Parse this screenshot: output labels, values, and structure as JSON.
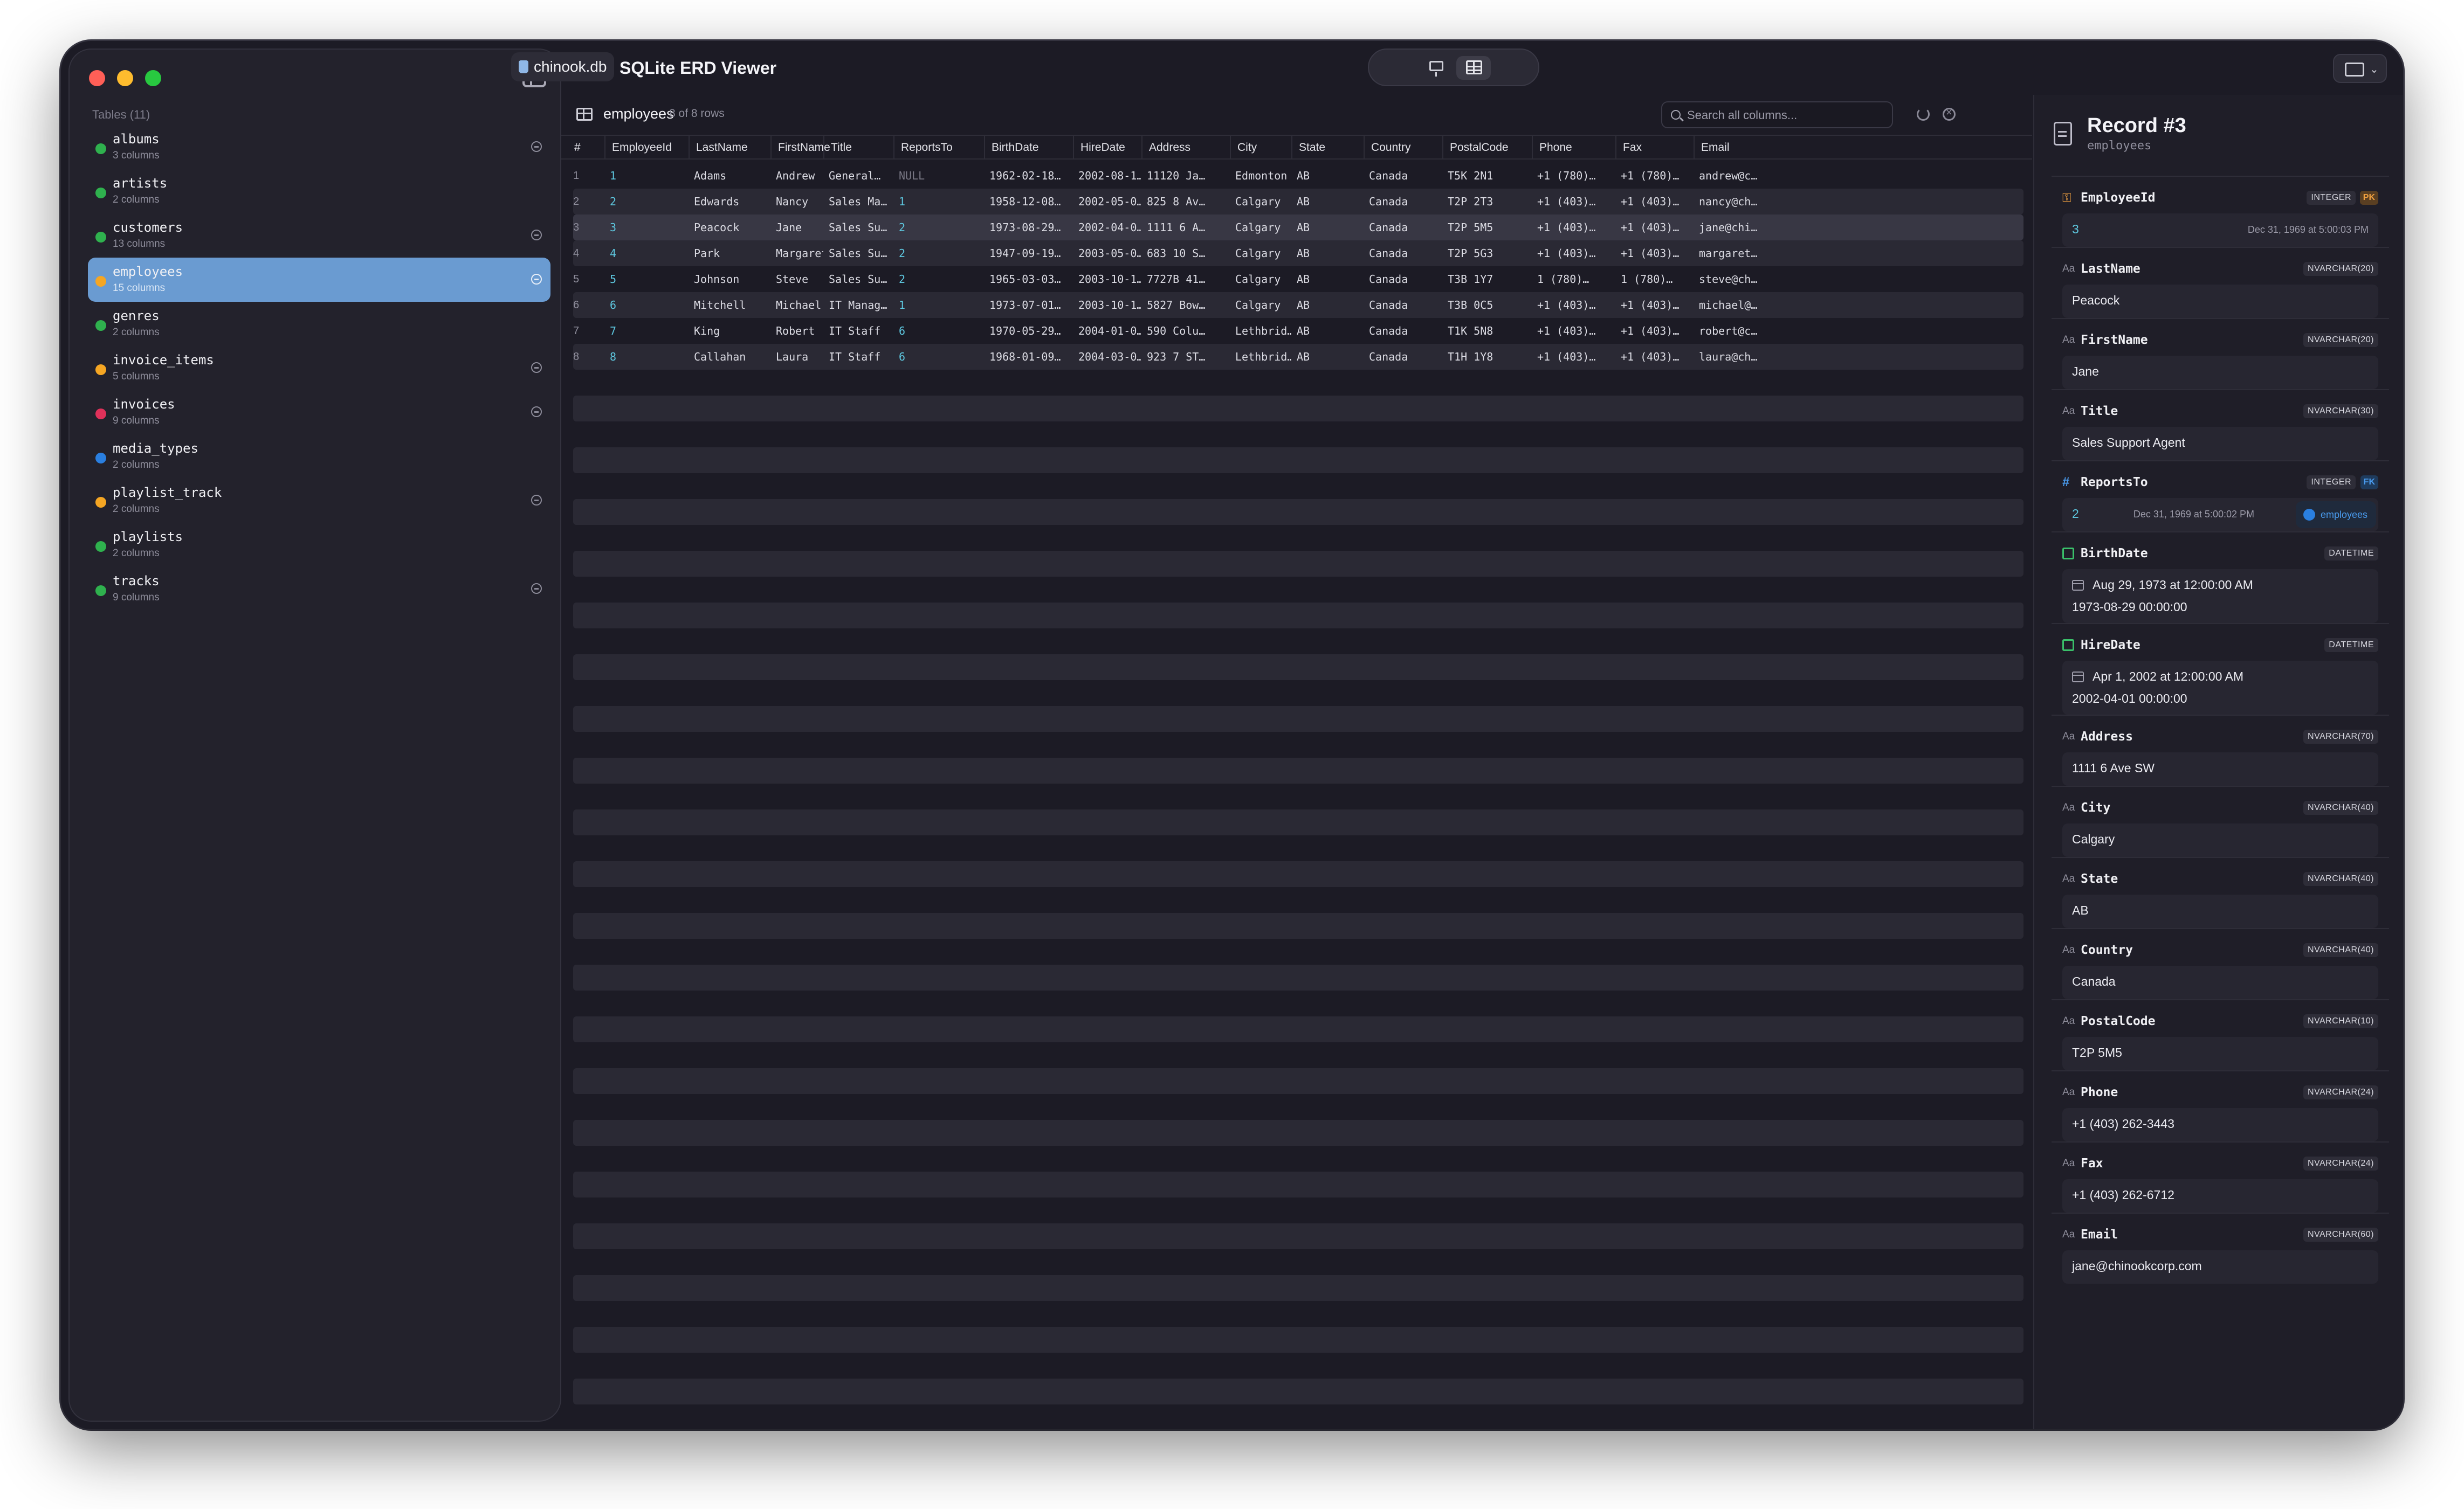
{
  "window": {
    "db_file": "chinook.db",
    "app_title": "SQLite ERD Viewer"
  },
  "sidebar": {
    "header": "Tables (11)",
    "tables": [
      {
        "name": "albums",
        "columns": "3 columns",
        "color": "#2fb14e",
        "linked": true
      },
      {
        "name": "artists",
        "columns": "2 columns",
        "color": "#2fb14e",
        "linked": false
      },
      {
        "name": "customers",
        "columns": "13 columns",
        "color": "#2fb14e",
        "linked": true
      },
      {
        "name": "employees",
        "columns": "15 columns",
        "color": "#f5a623",
        "linked": true,
        "selected": true
      },
      {
        "name": "genres",
        "columns": "2 columns",
        "color": "#2fb14e",
        "linked": false
      },
      {
        "name": "invoice_items",
        "columns": "5 columns",
        "color": "#f5a623",
        "linked": true
      },
      {
        "name": "invoices",
        "columns": "9 columns",
        "color": "#e0315a",
        "linked": true
      },
      {
        "name": "media_types",
        "columns": "2 columns",
        "color": "#2a7fe0",
        "linked": false
      },
      {
        "name": "playlist_track",
        "columns": "2 columns",
        "color": "#f5a623",
        "linked": true
      },
      {
        "name": "playlists",
        "columns": "2 columns",
        "color": "#2fb14e",
        "linked": false
      },
      {
        "name": "tracks",
        "columns": "9 columns",
        "color": "#2fb14e",
        "linked": true
      }
    ]
  },
  "table_view": {
    "table_name": "employees",
    "row_count": "8 of 8 rows",
    "search_placeholder": "Search all columns...",
    "columns": [
      "#",
      "EmployeeId",
      "LastName",
      "FirstName",
      "Title",
      "ReportsTo",
      "BirthDate",
      "HireDate",
      "Address",
      "City",
      "State",
      "Country",
      "PostalCode",
      "Phone",
      "Fax",
      "Email"
    ],
    "rows": [
      [
        "1",
        "1",
        "Adams",
        "Andrew",
        "General…",
        "NULL",
        "1962-02-18…",
        "2002-08-1…",
        "11120 Ja…",
        "Edmonton",
        "AB",
        "Canada",
        "T5K 2N1",
        "+1 (780)…",
        "+1 (780)…",
        "andrew@c…"
      ],
      [
        "2",
        "2",
        "Edwards",
        "Nancy",
        "Sales Ma…",
        "1",
        "1958-12-08…",
        "2002-05-0…",
        "825 8 Av…",
        "Calgary",
        "AB",
        "Canada",
        "T2P 2T3",
        "+1 (403)…",
        "+1 (403)…",
        "nancy@ch…"
      ],
      [
        "3",
        "3",
        "Peacock",
        "Jane",
        "Sales Su…",
        "2",
        "1973-08-29…",
        "2002-04-0…",
        "1111 6 A…",
        "Calgary",
        "AB",
        "Canada",
        "T2P 5M5",
        "+1 (403)…",
        "+1 (403)…",
        "jane@chi…"
      ],
      [
        "4",
        "4",
        "Park",
        "Margaret",
        "Sales Su…",
        "2",
        "1947-09-19…",
        "2003-05-0…",
        "683 10 S…",
        "Calgary",
        "AB",
        "Canada",
        "T2P 5G3",
        "+1 (403)…",
        "+1 (403)…",
        "margaret…"
      ],
      [
        "5",
        "5",
        "Johnson",
        "Steve",
        "Sales Su…",
        "2",
        "1965-03-03…",
        "2003-10-1…",
        "7727B 41…",
        "Calgary",
        "AB",
        "Canada",
        "T3B 1Y7",
        "1 (780)…",
        "1 (780)…",
        "steve@ch…"
      ],
      [
        "6",
        "6",
        "Mitchell",
        "Michael",
        "IT Manag…",
        "1",
        "1973-07-01…",
        "2003-10-1…",
        "5827 Bow…",
        "Calgary",
        "AB",
        "Canada",
        "T3B 0C5",
        "+1 (403)…",
        "+1 (403)…",
        "michael@…"
      ],
      [
        "7",
        "7",
        "King",
        "Robert",
        "IT Staff",
        "6",
        "1970-05-29…",
        "2004-01-0…",
        "590 Colu…",
        "Lethbrid…",
        "AB",
        "Canada",
        "T1K 5N8",
        "+1 (403)…",
        "+1 (403)…",
        "robert@c…"
      ],
      [
        "8",
        "8",
        "Callahan",
        "Laura",
        "IT Staff",
        "6",
        "1968-01-09…",
        "2004-03-0…",
        "923 7 ST…",
        "Lethbrid…",
        "AB",
        "Canada",
        "T1H 1Y8",
        "+1 (403)…",
        "+1 (403)…",
        "laura@ch…"
      ]
    ],
    "selected_row": 3
  },
  "record": {
    "title": "Record #3",
    "table": "employees",
    "employee_id": {
      "name": "EmployeeId",
      "type": "INTEGER",
      "key": "PK",
      "value": "3",
      "note": "Dec 31, 1969 at 5:00:03 PM"
    },
    "last_name": {
      "name": "LastName",
      "type": "NVARCHAR(20)",
      "value": "Peacock"
    },
    "first_name": {
      "name": "FirstName",
      "type": "NVARCHAR(20)",
      "value": "Jane"
    },
    "title_field": {
      "name": "Title",
      "type": "NVARCHAR(30)",
      "value": "Sales Support Agent"
    },
    "reports_to": {
      "name": "ReportsTo",
      "type": "INTEGER",
      "key": "FK",
      "value": "2",
      "note": "Dec 31, 1969 at 5:00:02 PM",
      "link": "employees"
    },
    "birth_date": {
      "name": "BirthDate",
      "type": "DATETIME",
      "formatted": "Aug 29, 1973 at 12:00:00 AM",
      "raw": "1973-08-29 00:00:00"
    },
    "hire_date": {
      "name": "HireDate",
      "type": "DATETIME",
      "formatted": "Apr 1, 2002 at 12:00:00 AM",
      "raw": "2002-04-01 00:00:00"
    },
    "address": {
      "name": "Address",
      "type": "NVARCHAR(70)",
      "value": "1111 6 Ave SW"
    },
    "city": {
      "name": "City",
      "type": "NVARCHAR(40)",
      "value": "Calgary"
    },
    "state": {
      "name": "State",
      "type": "NVARCHAR(40)",
      "value": "AB"
    },
    "country": {
      "name": "Country",
      "type": "NVARCHAR(40)",
      "value": "Canada"
    },
    "postal_code": {
      "name": "PostalCode",
      "type": "NVARCHAR(10)",
      "value": "T2P 5M5"
    },
    "phone": {
      "name": "Phone",
      "type": "NVARCHAR(24)",
      "value": "+1 (403) 262-3443"
    },
    "fax": {
      "name": "Fax",
      "type": "NVARCHAR(24)",
      "value": "+1 (403) 262-6712"
    },
    "email": {
      "name": "Email",
      "type": "NVARCHAR(60)",
      "value": "jane@chinookcorp.com"
    },
    "text_icon": "Aa"
  }
}
